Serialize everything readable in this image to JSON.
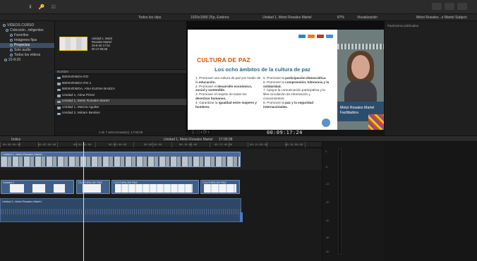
{
  "titlebar": {
    "left_icons": [
      "⬇",
      "🔑",
      "☑"
    ]
  },
  "toolbar": {
    "library_label": "Todos los clips",
    "format_label": "1920x1080 25p, Estéreo",
    "clip_title": "Unidad 1, Metzi Rosales Martel",
    "zoom": "87%",
    "view_label": "Visualización",
    "inspector_label": "Metzi Rosales...o Martel Subject"
  },
  "sidebar": {
    "items": [
      {
        "label": "VIDEOS CURSO",
        "selected": false
      },
      {
        "label": "Colección...teligentes",
        "selected": false
      },
      {
        "label": "Favoritos",
        "selected": false
      },
      {
        "label": "Imágenes fijas",
        "selected": false
      },
      {
        "label": "Proyectos",
        "selected": true
      },
      {
        "label": "Solo audio",
        "selected": false
      },
      {
        "label": "Todos los vídeos",
        "selected": false
      },
      {
        "label": "22-8-20",
        "selected": false
      }
    ]
  },
  "browser": {
    "thumb_lines": [
      "Unidad 1, Metzi",
      "Rosales Martel",
      "25-8-20 17:51",
      "00:17:06:06"
    ],
    "list_header": "Nombre",
    "rows": [
      {
        "label": "BIENVENIDA RO",
        "selected": false
      },
      {
        "label": "BIENVENIDA RO 1",
        "selected": false
      },
      {
        "label": "BIENVENIDA, ANA ELENA BAEZA",
        "selected": false
      },
      {
        "label": "Unidad 1, Alma Pérez",
        "selected": false
      },
      {
        "label": "Unidad 1, Metzi Rosales Martel",
        "selected": true
      },
      {
        "label": "Unidad 1, Marcia Aguilar",
        "selected": false
      },
      {
        "label": "Unidad 2, Miriam Benites",
        "selected": false
      }
    ],
    "footer": "1 de 7 seleccionado(s), 17:06:08"
  },
  "slide": {
    "title": "CULTURA DE PAZ",
    "subtitle": "Los ocho ámbitos de la cultura de paz",
    "left_items": [
      {
        "n": "1.",
        "text": "Promover una cultura de paz por medio de la ",
        "bold": "educación."
      },
      {
        "n": "2.",
        "text": "Promover el ",
        "bold": "desarrollo económico, social y sostenible."
      },
      {
        "n": "3.",
        "text": "Promover el respeto de todos los ",
        "bold": "derechos humanos."
      },
      {
        "n": "4.",
        "text": "Garantizar la ",
        "bold": "igualdad entre mujeres y hombres."
      }
    ],
    "right_items": [
      {
        "n": "5.",
        "text": "Promover la ",
        "bold": "participación democrática."
      },
      {
        "n": "6.",
        "text": "Promover la ",
        "bold": "comprensión, tolerancia y la solidaridad."
      },
      {
        "n": "7.",
        "text": "Apoyar la comunicación participativa y la libre circulación de información y conocimientos.",
        "bold": ""
      },
      {
        "n": "8.",
        "text": "Promover la ",
        "bold": "paz y la seguridad internacionales."
      }
    ]
  },
  "camera": {
    "name": "Metzi Rosales Martel",
    "role": "Facilitadora"
  },
  "viewer": {
    "timecode": "00:09:17:24",
    "left_controls": "⌶ · ⛶ ▾  ⟳ ▾"
  },
  "inspector": {
    "header": "Parámetros publicados"
  },
  "timeline": {
    "index_label": "Índice",
    "project_label": "Unidad 1, Metzi Rosales Martel",
    "duration": "17:06:08",
    "ruler_labels": [
      "00:00:00:00",
      "00:02:00:00",
      "00:04:00:00",
      "00:06:00:00",
      "00:08:00:00",
      "00:10:00:00",
      "00:12:00:00",
      "00:14:00:00",
      "00:16:00:00"
    ],
    "video_clip_label": "Unidad 1, Metzi Rosales Martel",
    "secondary_labels": [
      "Unidad 1",
      "CULTURA DE PAZ",
      "CULTURA DE PAZ",
      "CULTURA DE PAZ"
    ],
    "audio_label": "Unidad 1, Metzi Rosales Martel"
  },
  "meter": {
    "labels": [
      "0",
      "-6",
      "-12",
      "-20",
      "-30",
      "-40",
      "-50"
    ]
  }
}
